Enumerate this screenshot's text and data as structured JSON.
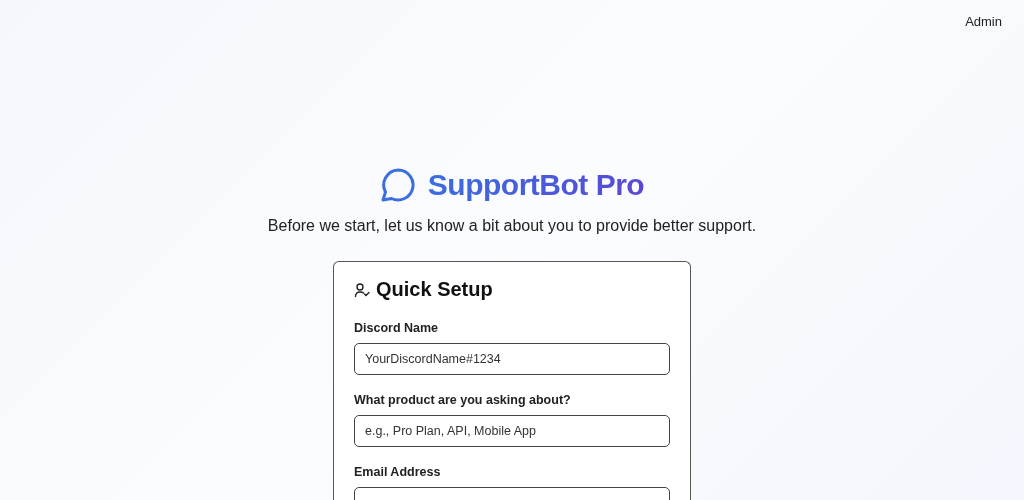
{
  "nav": {
    "link": "Admin"
  },
  "brand": {
    "title": "SupportBot Pro",
    "subtitle": "Before we start, let us know a bit about you to provide better support."
  },
  "card": {
    "title": "Quick Setup",
    "fields": [
      {
        "label": "Discord Name",
        "placeholder": "YourDiscordName#1234"
      },
      {
        "label": "What product are you asking about?",
        "placeholder": "e.g., Pro Plan, API, Mobile App"
      },
      {
        "label": "Email Address"
      }
    ]
  }
}
